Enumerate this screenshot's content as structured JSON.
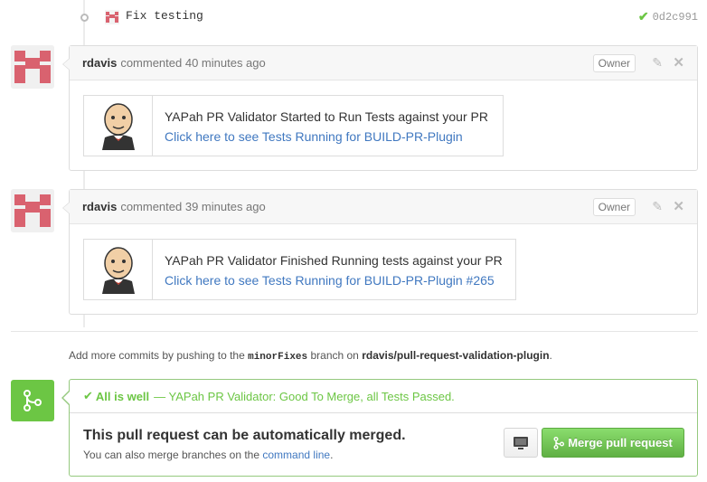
{
  "commit": {
    "message": "Fix testing",
    "sha": "0d2c991",
    "status_icon": "check-icon"
  },
  "comments": [
    {
      "author": "rdavis",
      "action": "commented",
      "time": "40 minutes ago",
      "badge": "Owner",
      "card_line1": "YAPah PR Validator Started to Run Tests against your PR",
      "card_link": "Click here to see Tests Running for BUILD-PR-Plugin"
    },
    {
      "author": "rdavis",
      "action": "commented",
      "time": "39 minutes ago",
      "badge": "Owner",
      "card_line1": "YAPah PR Validator Finished Running tests against your PR",
      "card_link": "Click here to see Tests Running for BUILD-PR-Plugin #265"
    }
  ],
  "push_note": {
    "prefix": "Add more commits by pushing to the",
    "branch": "minorFixes",
    "middle": "branch on",
    "repo": "rdavis/pull-request-validation-plugin",
    "suffix": "."
  },
  "merge": {
    "status_ok": "All is well",
    "status_detail": "— YAPah PR Validator: Good To Merge, all Tests Passed.",
    "title": "This pull request can be automatically merged.",
    "sub_prefix": "You can also merge branches on the",
    "sub_link": "command line",
    "sub_suffix": ".",
    "button_label": "Merge pull request"
  },
  "colors": {
    "green": "#6cc644",
    "link": "#4078c0",
    "avatar_pink": "#d9626f"
  }
}
